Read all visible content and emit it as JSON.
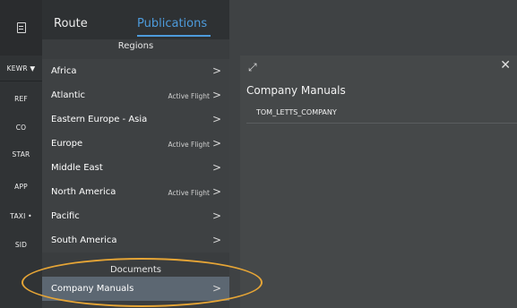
{
  "rail": {
    "items": [
      {
        "label": "KEWR ▼"
      },
      {
        "label": "REF"
      },
      {
        "label": "CO"
      },
      {
        "label": "STAR"
      },
      {
        "label": "APP"
      },
      {
        "label": "TAXI •"
      },
      {
        "label": "SID"
      }
    ]
  },
  "tabs": [
    {
      "label": "Route",
      "active": false
    },
    {
      "label": "Publications",
      "active": true
    }
  ],
  "regions": {
    "header": "Regions",
    "items": [
      {
        "label": "Africa",
        "badge": ""
      },
      {
        "label": "Atlantic",
        "badge": "Active Flight"
      },
      {
        "label": "Eastern Europe - Asia",
        "badge": ""
      },
      {
        "label": "Europe",
        "badge": "Active Flight"
      },
      {
        "label": "Middle East",
        "badge": ""
      },
      {
        "label": "North America",
        "badge": "Active Flight"
      },
      {
        "label": "Pacific",
        "badge": ""
      },
      {
        "label": "South America",
        "badge": ""
      }
    ]
  },
  "documents": {
    "header": "Documents",
    "items": [
      {
        "label": "Company Manuals",
        "selected": true
      }
    ]
  },
  "panel": {
    "title": "Company Manuals",
    "items": [
      "TOM_LETTS_COMPANY"
    ]
  },
  "colors": {
    "accent": "#4d9bdc",
    "highlight": "#e6a536",
    "selected_row": "#5c6772"
  }
}
